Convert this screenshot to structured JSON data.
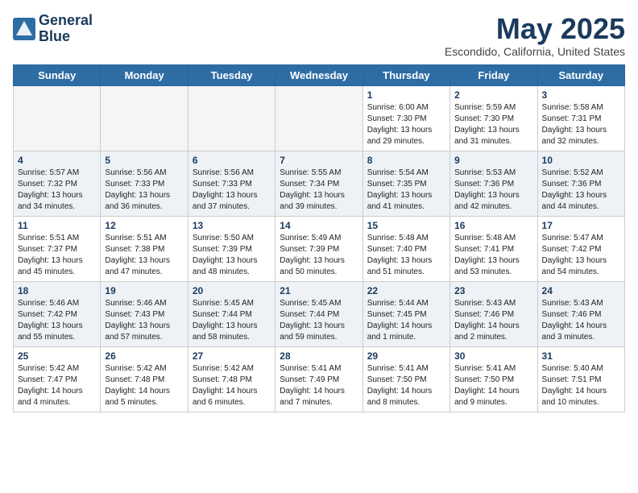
{
  "header": {
    "logo_line1": "General",
    "logo_line2": "Blue",
    "month": "May 2025",
    "location": "Escondido, California, United States"
  },
  "weekdays": [
    "Sunday",
    "Monday",
    "Tuesday",
    "Wednesday",
    "Thursday",
    "Friday",
    "Saturday"
  ],
  "weeks": [
    [
      {
        "day": "",
        "sunrise": "",
        "sunset": "",
        "daylight": ""
      },
      {
        "day": "",
        "sunrise": "",
        "sunset": "",
        "daylight": ""
      },
      {
        "day": "",
        "sunrise": "",
        "sunset": "",
        "daylight": ""
      },
      {
        "day": "",
        "sunrise": "",
        "sunset": "",
        "daylight": ""
      },
      {
        "day": "1",
        "sunrise": "Sunrise: 6:00 AM",
        "sunset": "Sunset: 7:30 PM",
        "daylight": "Daylight: 13 hours and 29 minutes."
      },
      {
        "day": "2",
        "sunrise": "Sunrise: 5:59 AM",
        "sunset": "Sunset: 7:30 PM",
        "daylight": "Daylight: 13 hours and 31 minutes."
      },
      {
        "day": "3",
        "sunrise": "Sunrise: 5:58 AM",
        "sunset": "Sunset: 7:31 PM",
        "daylight": "Daylight: 13 hours and 32 minutes."
      }
    ],
    [
      {
        "day": "4",
        "sunrise": "Sunrise: 5:57 AM",
        "sunset": "Sunset: 7:32 PM",
        "daylight": "Daylight: 13 hours and 34 minutes."
      },
      {
        "day": "5",
        "sunrise": "Sunrise: 5:56 AM",
        "sunset": "Sunset: 7:33 PM",
        "daylight": "Daylight: 13 hours and 36 minutes."
      },
      {
        "day": "6",
        "sunrise": "Sunrise: 5:56 AM",
        "sunset": "Sunset: 7:33 PM",
        "daylight": "Daylight: 13 hours and 37 minutes."
      },
      {
        "day": "7",
        "sunrise": "Sunrise: 5:55 AM",
        "sunset": "Sunset: 7:34 PM",
        "daylight": "Daylight: 13 hours and 39 minutes."
      },
      {
        "day": "8",
        "sunrise": "Sunrise: 5:54 AM",
        "sunset": "Sunset: 7:35 PM",
        "daylight": "Daylight: 13 hours and 41 minutes."
      },
      {
        "day": "9",
        "sunrise": "Sunrise: 5:53 AM",
        "sunset": "Sunset: 7:36 PM",
        "daylight": "Daylight: 13 hours and 42 minutes."
      },
      {
        "day": "10",
        "sunrise": "Sunrise: 5:52 AM",
        "sunset": "Sunset: 7:36 PM",
        "daylight": "Daylight: 13 hours and 44 minutes."
      }
    ],
    [
      {
        "day": "11",
        "sunrise": "Sunrise: 5:51 AM",
        "sunset": "Sunset: 7:37 PM",
        "daylight": "Daylight: 13 hours and 45 minutes."
      },
      {
        "day": "12",
        "sunrise": "Sunrise: 5:51 AM",
        "sunset": "Sunset: 7:38 PM",
        "daylight": "Daylight: 13 hours and 47 minutes."
      },
      {
        "day": "13",
        "sunrise": "Sunrise: 5:50 AM",
        "sunset": "Sunset: 7:39 PM",
        "daylight": "Daylight: 13 hours and 48 minutes."
      },
      {
        "day": "14",
        "sunrise": "Sunrise: 5:49 AM",
        "sunset": "Sunset: 7:39 PM",
        "daylight": "Daylight: 13 hours and 50 minutes."
      },
      {
        "day": "15",
        "sunrise": "Sunrise: 5:48 AM",
        "sunset": "Sunset: 7:40 PM",
        "daylight": "Daylight: 13 hours and 51 minutes."
      },
      {
        "day": "16",
        "sunrise": "Sunrise: 5:48 AM",
        "sunset": "Sunset: 7:41 PM",
        "daylight": "Daylight: 13 hours and 53 minutes."
      },
      {
        "day": "17",
        "sunrise": "Sunrise: 5:47 AM",
        "sunset": "Sunset: 7:42 PM",
        "daylight": "Daylight: 13 hours and 54 minutes."
      }
    ],
    [
      {
        "day": "18",
        "sunrise": "Sunrise: 5:46 AM",
        "sunset": "Sunset: 7:42 PM",
        "daylight": "Daylight: 13 hours and 55 minutes."
      },
      {
        "day": "19",
        "sunrise": "Sunrise: 5:46 AM",
        "sunset": "Sunset: 7:43 PM",
        "daylight": "Daylight: 13 hours and 57 minutes."
      },
      {
        "day": "20",
        "sunrise": "Sunrise: 5:45 AM",
        "sunset": "Sunset: 7:44 PM",
        "daylight": "Daylight: 13 hours and 58 minutes."
      },
      {
        "day": "21",
        "sunrise": "Sunrise: 5:45 AM",
        "sunset": "Sunset: 7:44 PM",
        "daylight": "Daylight: 13 hours and 59 minutes."
      },
      {
        "day": "22",
        "sunrise": "Sunrise: 5:44 AM",
        "sunset": "Sunset: 7:45 PM",
        "daylight": "Daylight: 14 hours and 1 minute."
      },
      {
        "day": "23",
        "sunrise": "Sunrise: 5:43 AM",
        "sunset": "Sunset: 7:46 PM",
        "daylight": "Daylight: 14 hours and 2 minutes."
      },
      {
        "day": "24",
        "sunrise": "Sunrise: 5:43 AM",
        "sunset": "Sunset: 7:46 PM",
        "daylight": "Daylight: 14 hours and 3 minutes."
      }
    ],
    [
      {
        "day": "25",
        "sunrise": "Sunrise: 5:42 AM",
        "sunset": "Sunset: 7:47 PM",
        "daylight": "Daylight: 14 hours and 4 minutes."
      },
      {
        "day": "26",
        "sunrise": "Sunrise: 5:42 AM",
        "sunset": "Sunset: 7:48 PM",
        "daylight": "Daylight: 14 hours and 5 minutes."
      },
      {
        "day": "27",
        "sunrise": "Sunrise: 5:42 AM",
        "sunset": "Sunset: 7:48 PM",
        "daylight": "Daylight: 14 hours and 6 minutes."
      },
      {
        "day": "28",
        "sunrise": "Sunrise: 5:41 AM",
        "sunset": "Sunset: 7:49 PM",
        "daylight": "Daylight: 14 hours and 7 minutes."
      },
      {
        "day": "29",
        "sunrise": "Sunrise: 5:41 AM",
        "sunset": "Sunset: 7:50 PM",
        "daylight": "Daylight: 14 hours and 8 minutes."
      },
      {
        "day": "30",
        "sunrise": "Sunrise: 5:41 AM",
        "sunset": "Sunset: 7:50 PM",
        "daylight": "Daylight: 14 hours and 9 minutes."
      },
      {
        "day": "31",
        "sunrise": "Sunrise: 5:40 AM",
        "sunset": "Sunset: 7:51 PM",
        "daylight": "Daylight: 14 hours and 10 minutes."
      }
    ]
  ]
}
